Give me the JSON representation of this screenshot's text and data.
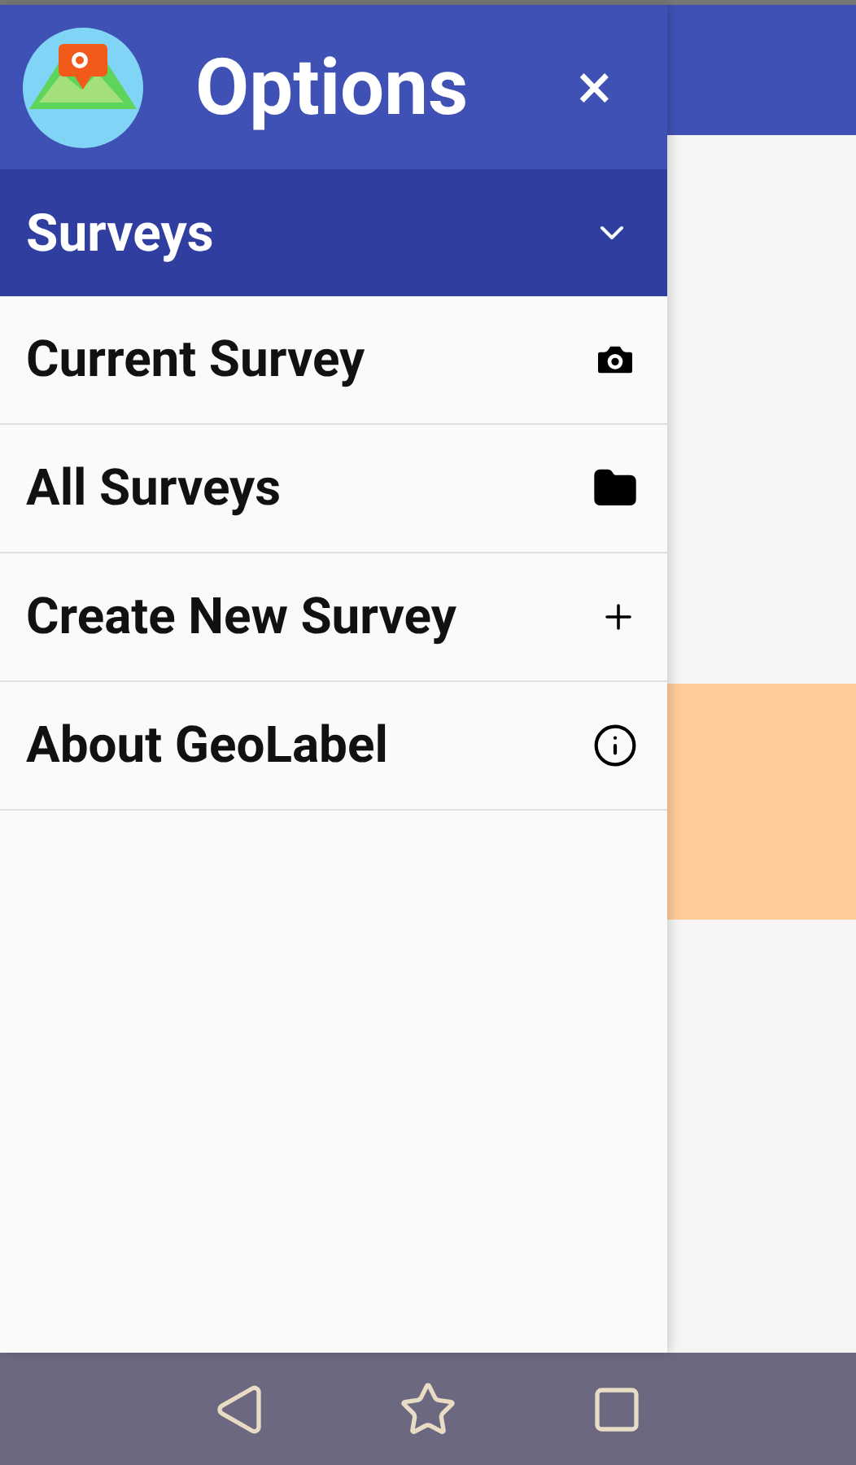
{
  "drawer": {
    "title": "Options",
    "close_label": "×"
  },
  "section": {
    "title": "Surveys",
    "expanded": true
  },
  "items": [
    {
      "label": "Current Survey",
      "kind": "camera"
    },
    {
      "label": "All Surveys",
      "kind": "folder"
    },
    {
      "label": "Create New Survey",
      "kind": "add"
    },
    {
      "label": "About GeoLabel",
      "kind": "info"
    }
  ]
}
